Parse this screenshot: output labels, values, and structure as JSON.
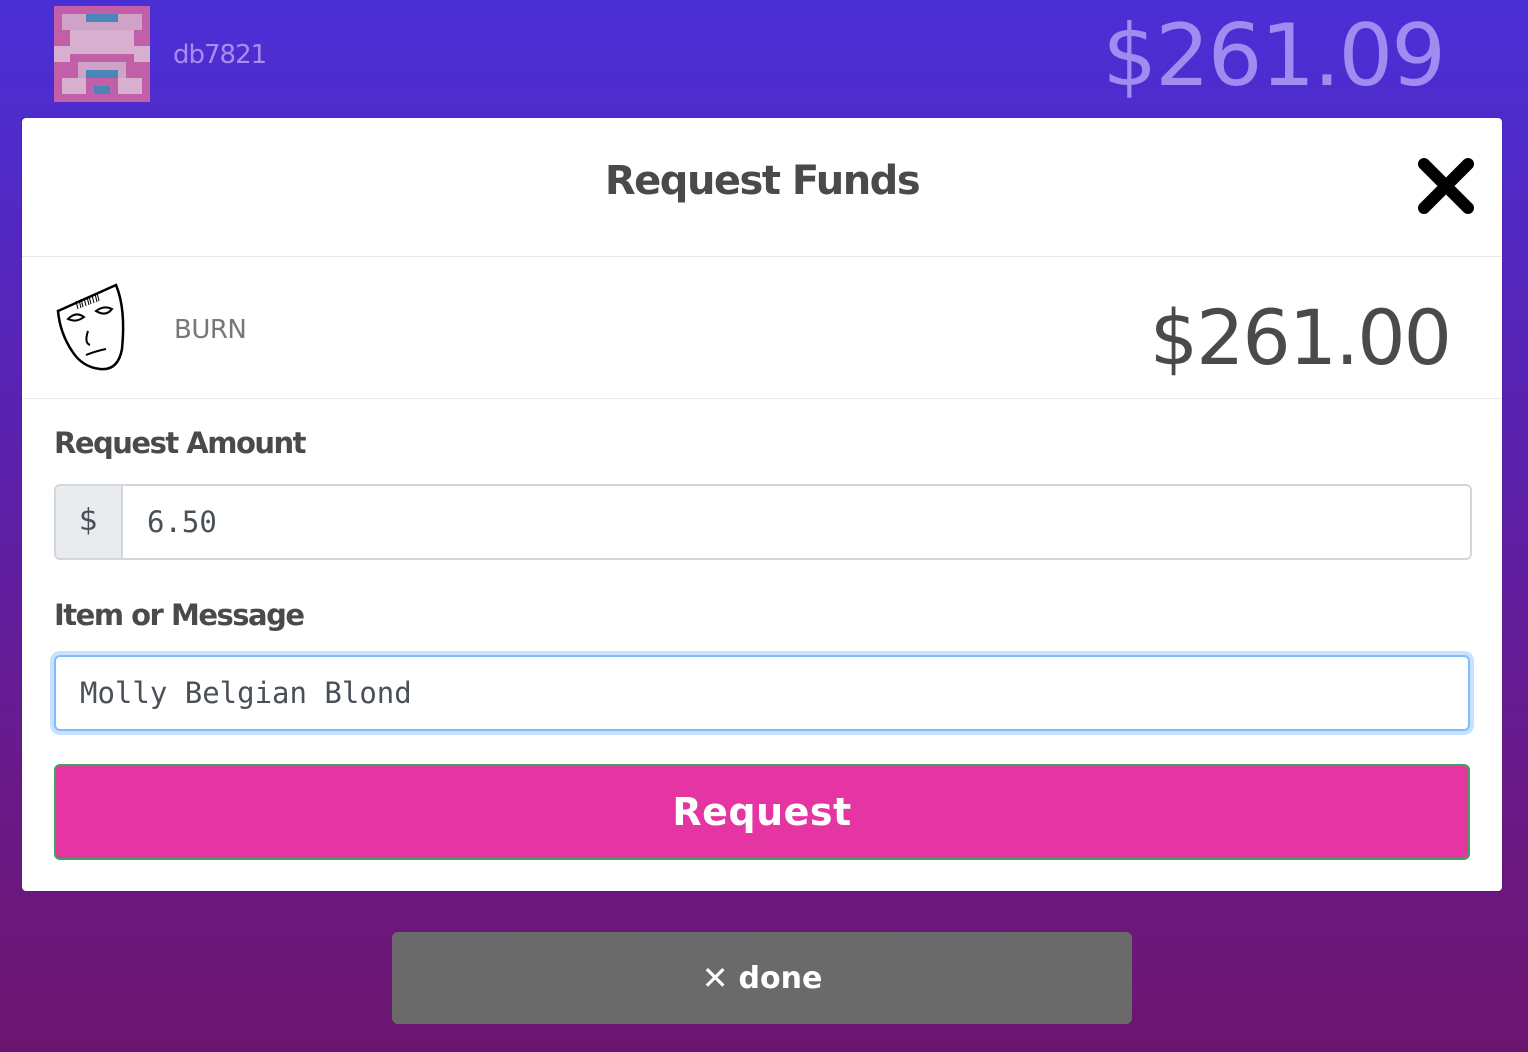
{
  "header": {
    "username": "db7821",
    "balance": "$261.09"
  },
  "modal": {
    "title": "Request Funds",
    "close_icon": "close-x-icon",
    "token": {
      "icon": "mask-barcode-icon",
      "name": "BURN",
      "balance": "$261.00"
    },
    "amount": {
      "label": "Request Amount",
      "prefix": "$",
      "value": "6.50"
    },
    "message": {
      "label": "Item or Message",
      "value": "Molly Belgian Blond"
    },
    "request_button": "Request"
  },
  "done_button": {
    "icon": "✕",
    "label": "done"
  },
  "colors": {
    "background_top": "#4a2fd6",
    "background_bottom": "#6c1570",
    "accent": "#e535a2",
    "done": "#6a6a6a"
  }
}
